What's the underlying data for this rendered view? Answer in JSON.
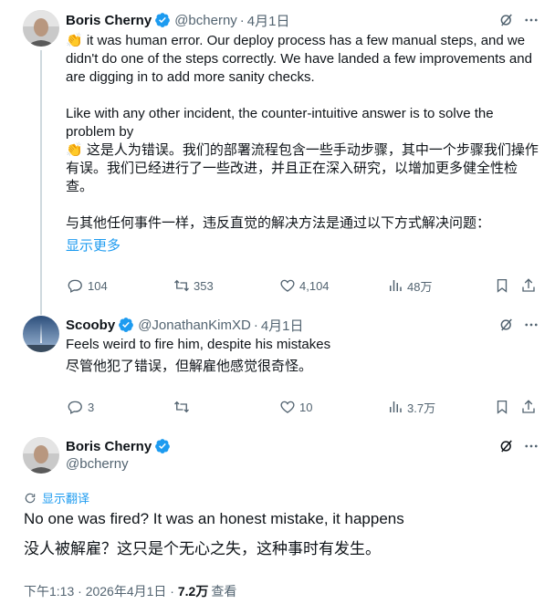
{
  "tweets": [
    {
      "author": "Boris Cherny",
      "handle": "@bcherny",
      "time": "4月1日",
      "paragraphs": [
        "👏 it was human error. Our deploy process has a few manual steps, and we didn't do one of the steps correctly. We have landed a few improvements and are digging in to add more sanity checks.",
        "Like with any other incident, the counter-intuitive answer is to solve the problem by",
        "👏 这是人为错误。我们的部署流程包含一些手动步骤，其中一个步骤我们操作有误。我们已经进行了一些改进，并且正在深入研究，以增加更多健全性检查。",
        "与其他任何事件一样，违反直觉的解决方法是通过以下方式解决问题："
      ],
      "show_more": "显示更多",
      "replies": "104",
      "retweets": "353",
      "likes": "4,104",
      "views": "48万"
    },
    {
      "author": "Scooby",
      "handle": "@JonathanKimXD",
      "time": "4月1日",
      "text_en": "Feels weird to fire him, despite his mistakes",
      "text_zh": "尽管他犯了错误，但解雇他感觉很奇怪。",
      "replies": "3",
      "retweets": "",
      "likes": "10",
      "views": "3.7万"
    }
  ],
  "main_tweet": {
    "author": "Boris Cherny",
    "handle": "@bcherny",
    "translate_label": "显示翻译",
    "text_en": "No one was fired? It was an honest mistake, it happens",
    "text_zh": "没人被解雇？这只是个无心之失，这种事时有发生。",
    "timestamp": "下午1:13 · 2026年4月1日 · ",
    "views": "7.2万",
    "views_label": "查看"
  },
  "icons": {
    "verified": "verified-badge-icon",
    "grok": "grok-icon",
    "reply": "reply-icon",
    "retweet": "retweet-icon",
    "like": "like-icon",
    "views": "views-icon",
    "bookmark": "bookmark-icon",
    "share": "share-icon",
    "translate": "translate-icon"
  },
  "colors": {
    "accent": "#1d9bf0",
    "text": "#0f1419",
    "secondary": "#536471"
  }
}
